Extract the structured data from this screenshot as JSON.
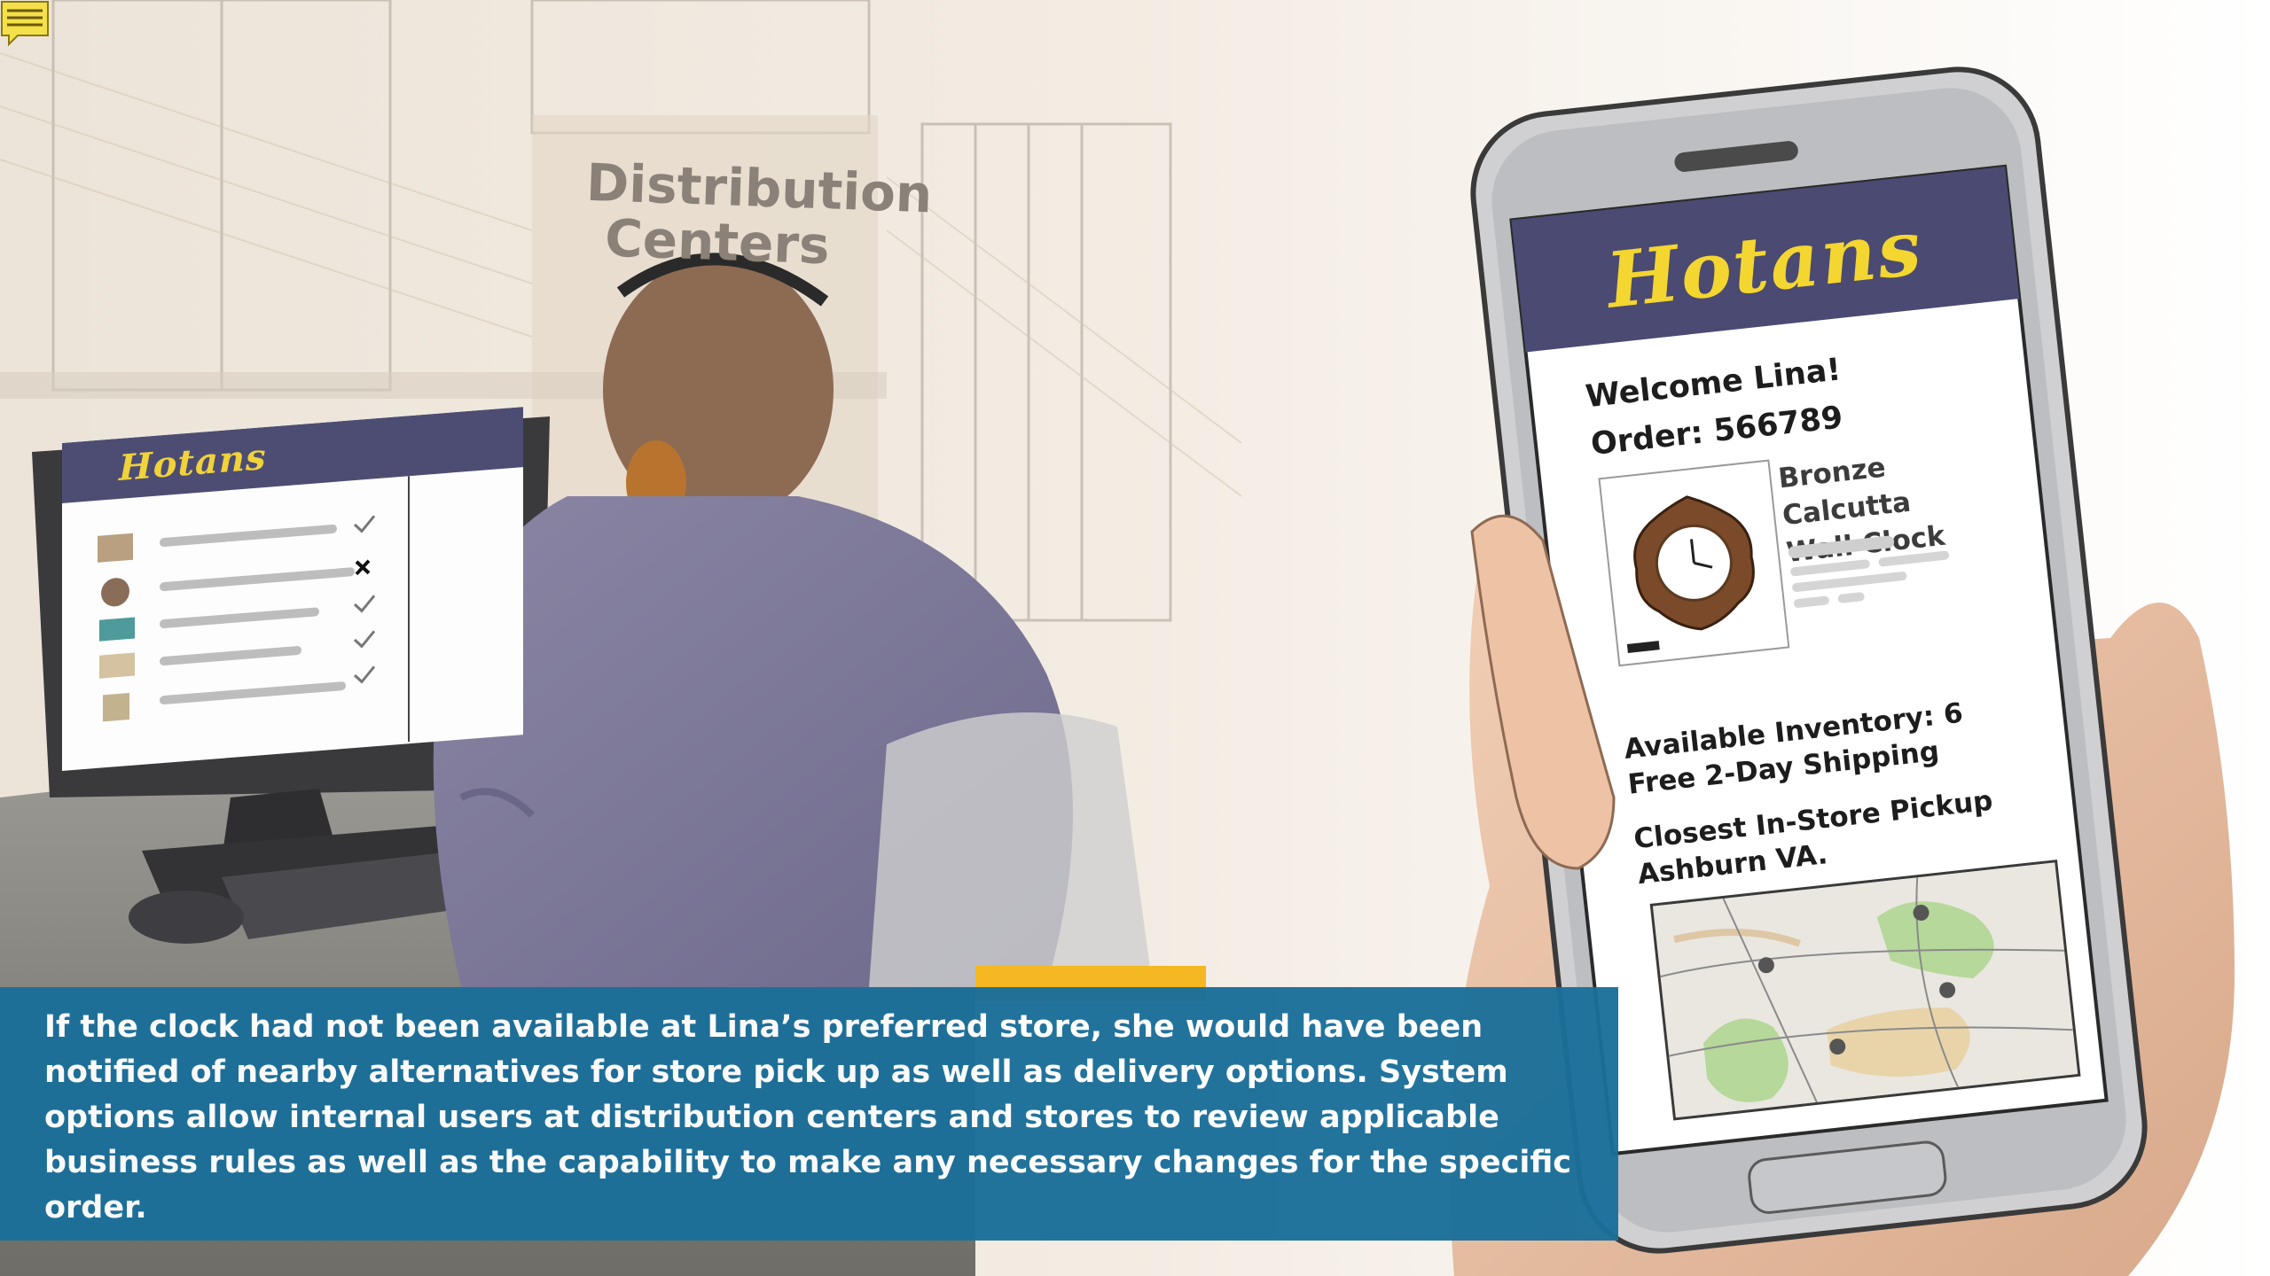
{
  "scene": {
    "sign": {
      "line1": "Distribution",
      "line2": "Centers"
    },
    "monitor": {
      "logo": "Hotans"
    },
    "phone": {
      "logo": "Hotans",
      "welcome": "Welcome Lina!",
      "order": "Order: 566789",
      "product_line1": "Bronze Calcutta",
      "product_line2": "Wall Clock",
      "inventory": "Available Inventory: 6",
      "shipping": "Free 2-Day Shipping",
      "pickup_label": "Closest In-Store Pickup",
      "pickup_location": "Ashburn VA."
    }
  },
  "caption": {
    "text": "If the clock had not been available at Lina’s preferred store, she would have been notified of nearby alternatives for store pick up as well as delivery options. System options allow internal users at distribution centers and stores to review applicable business rules as well as the capability to make any necessary changes for the specific order."
  },
  "colors": {
    "caption_bg": "#1a6f9a",
    "brand_header": "#4a4a72",
    "brand_logo": "#f4d630"
  }
}
